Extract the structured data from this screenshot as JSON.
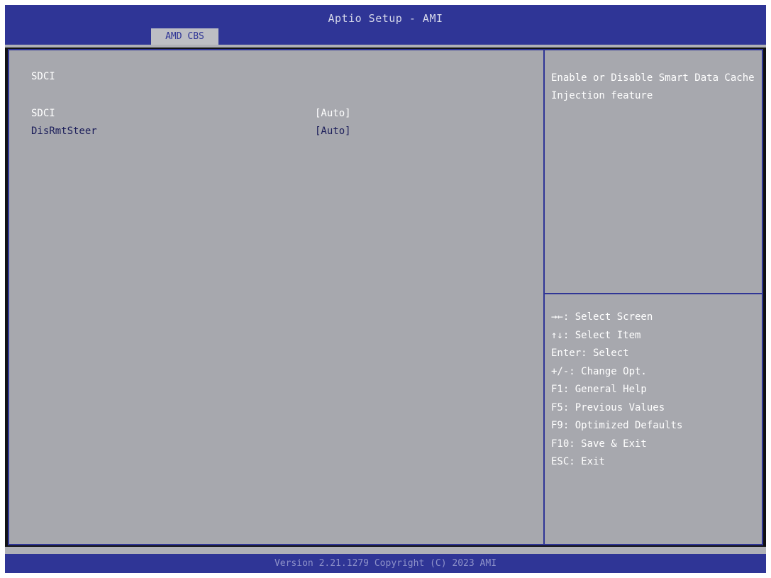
{
  "header": {
    "title": "Aptio Setup - AMI",
    "tabs": [
      {
        "label": "AMD CBS",
        "active": true
      }
    ]
  },
  "main": {
    "section_title": "SDCI",
    "settings": [
      {
        "label": "SDCI",
        "value": "[Auto]",
        "selected": true
      },
      {
        "label": "DisRmtSteer",
        "value": "[Auto]",
        "selected": false
      }
    ]
  },
  "help": {
    "description": "Enable or Disable Smart Data Cache Injection feature"
  },
  "keys": [
    "→←: Select Screen",
    "↑↓: Select Item",
    "Enter: Select",
    "+/-: Change Opt.",
    "F1: General Help",
    "F5: Previous Values",
    "F9: Optimized Defaults",
    "F10: Save & Exit",
    "ESC: Exit"
  ],
  "footer": {
    "version": "Version 2.21.1279 Copyright (C) 2023 AMI"
  },
  "colors": {
    "title_bar": "#2f3596",
    "panel_bg": "#a7a8ae",
    "selected_text": "#ffffff",
    "normal_text": "#1c1e5a"
  }
}
